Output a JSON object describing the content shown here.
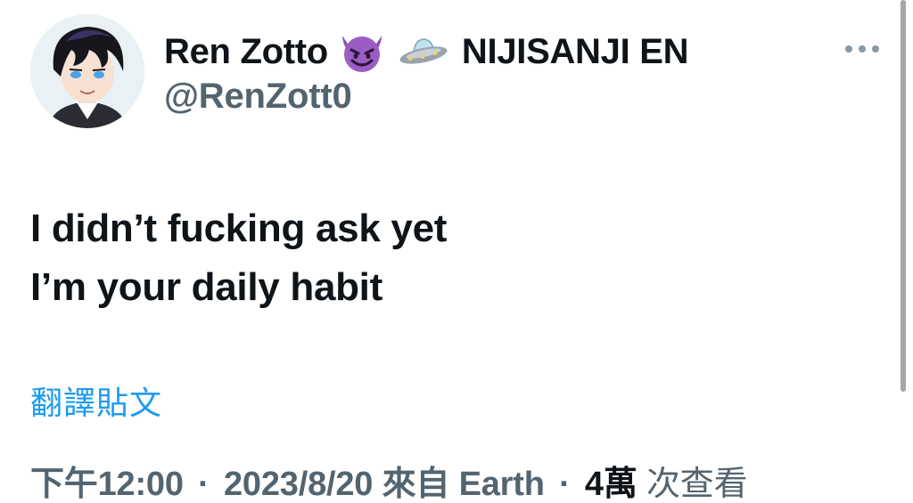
{
  "author": {
    "display_name": "Ren Zotto",
    "name_emojis": [
      "smiling-devil-icon",
      "flying-saucer-icon"
    ],
    "affiliation": "NIJISANJI EN",
    "handle": "@RenZott0"
  },
  "more_icon": "more-horizontal-icon",
  "tweet": {
    "lines": [
      "I didn’t fucking ask yet",
      "I’m your daily habit"
    ],
    "translate_label": "翻譯貼文"
  },
  "meta": {
    "time": "下午12:00",
    "separator": "·",
    "date": "2023/8/20",
    "source_prefix": "來自",
    "source": "Earth",
    "views_count": "4萬",
    "views_label": "次查看"
  },
  "colors": {
    "text_primary": "#0f1419",
    "text_secondary": "#536471",
    "link": "#1d9bf0"
  }
}
